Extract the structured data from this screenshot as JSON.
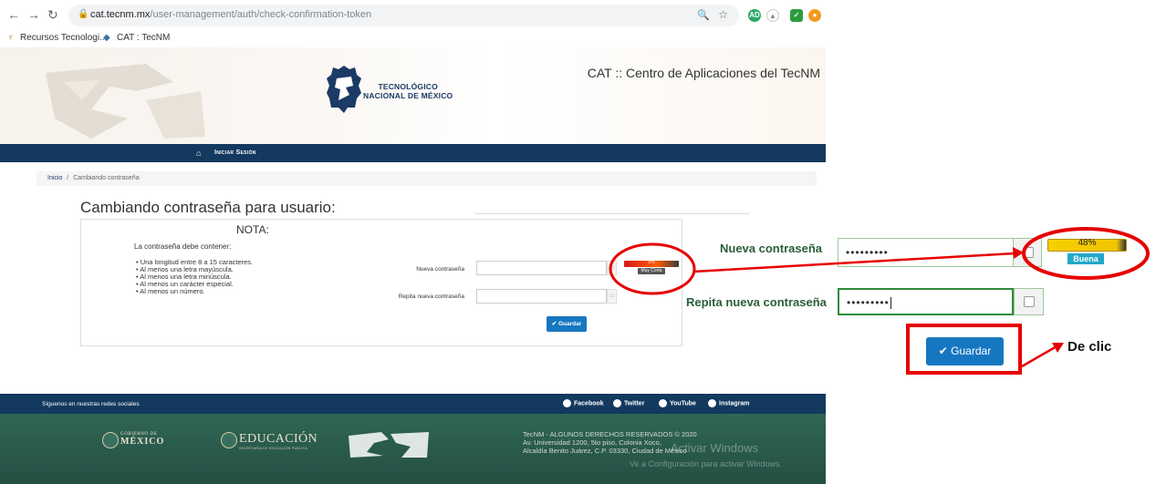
{
  "browser": {
    "url_host": "cat.tecnm.mx",
    "url_path": "/user-management/auth/check-confirmation-token",
    "bookmarks": [
      "Recursos Tecnologi...",
      "CAT : TecNM"
    ],
    "extension_badge": "AD"
  },
  "header": {
    "logo_text_1": "TECNOLÓGICO",
    "logo_text_2": "NACIONAL DE MÉXICO",
    "site_title": "CAT :: Centro de Aplicaciones del TecNM"
  },
  "nav": {
    "login": "Iniciar Sesión"
  },
  "breadcrumb": {
    "home": "Inicio",
    "separator": "/",
    "current": "Cambiando contraseña"
  },
  "form": {
    "title": "Cambiando contraseña para usuario:",
    "note_title": "NOTA:",
    "rules_heading": "La contraseña debe contener:",
    "rules": [
      "Una longitud entre 8 a 15 caracteres.",
      "Al menos una letra mayúscula.",
      "Al menos una letra minúscula.",
      "Al menos un carácter especial.",
      "Al menos un número."
    ],
    "new_password_label": "Nueva contraseña",
    "repeat_password_label": "Repita nueva contraseña",
    "strength_percent": "0%",
    "strength_label": "Muy Corta",
    "save_label": "Guardar"
  },
  "footer": {
    "follow_text": "Síguenos en nuestras redes sociales",
    "social": [
      "Facebook",
      "Twitter",
      "YouTube",
      "Instagram"
    ],
    "gob_small": "GOBIERNO DE",
    "gob_big": "MÉXICO",
    "edu": "EDUCACIÓN",
    "edu_sub": "SECRETARÍA DE EDUCACIÓN PÚBLICA",
    "copyright_1": "TecNM - ALGUNOS DERECHOS RESERVADOS © 2020",
    "copyright_2": "Av. Universidad 1200, 5to piso, Colonia Xoco,",
    "copyright_3": "Alcaldía Benito Juárez, C.P. 03330, Ciudad de México",
    "windows_1": "Activar Windows",
    "windows_2": "Ve a Configuración para activar Windows."
  },
  "callout": {
    "new_password_label": "Nueva contraseña",
    "repeat_password_label": "Repita nueva contraseña",
    "new_password_value": "•••••••••",
    "repeat_password_value": "•••••••••",
    "strength_percent": "48%",
    "strength_label": "Buena",
    "save_label": "Guardar",
    "instruction": "De clic"
  },
  "colors": {
    "navy": "#13395f",
    "footer_green": "#2c5e50",
    "primary_button": "#1677c1",
    "annotation_red": "#e60000",
    "label_green": "#2a5e3a"
  }
}
